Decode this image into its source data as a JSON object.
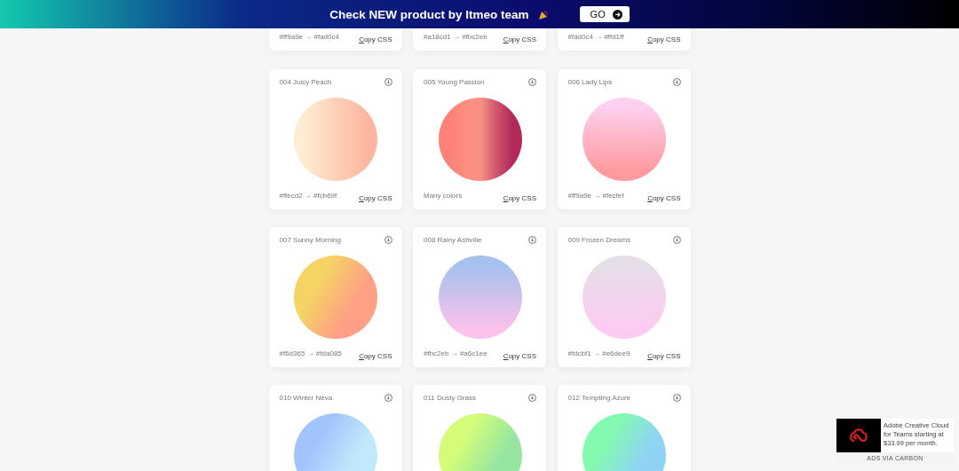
{
  "banner": {
    "text": "Check NEW product by Itmeo team",
    "button": "GO"
  },
  "cards": [
    {
      "colors_text": "#ff9a9e → #fad0c4",
      "copy": "Copy CSS"
    },
    {
      "colors_text": "#a18cd1 → #fbc2eb",
      "copy": "Copy CSS"
    },
    {
      "colors_text": "#fad0c4 → #ffd1ff",
      "copy": "Copy CSS"
    },
    {
      "title": "004 Juicy Peach",
      "swatch": {
        "kind": "horizontal",
        "stops": [
          {
            "color": "#ffecd2"
          },
          {
            "color": "#fcb69f"
          }
        ]
      },
      "colors_text": "#ffecd2 → #fcb69f",
      "copy": "Copy CSS"
    },
    {
      "title": "005 Young Passion",
      "swatch": {
        "kind": "horizontal",
        "stops": [
          {
            "color": "#ff8177"
          },
          {
            "color": "#ff8c7f"
          },
          {
            "color": "#f99185"
          },
          {
            "color": "#cf556c"
          },
          {
            "color": "#b12a5b"
          }
        ]
      },
      "colors_text": "Many colors",
      "copy": "Copy CSS"
    },
    {
      "title": "006 Lady Lips",
      "swatch": {
        "kind": "vertical",
        "stops": [
          {
            "color": "#ff9a9e"
          },
          {
            "color": "#fecfef"
          }
        ]
      },
      "colors_text": "#ff9a9e → #fecfef",
      "copy": "Copy CSS"
    },
    {
      "title": "007 Sunny Morning",
      "swatch": {
        "kind": "diagonal",
        "stops": [
          {
            "color": "#f6d365"
          },
          {
            "color": "#fda085"
          }
        ]
      },
      "colors_text": "#f6d365 → #fda085",
      "copy": "Copy CSS"
    },
    {
      "title": "008 Rainy Ashville",
      "swatch": {
        "kind": "vertical",
        "stops": [
          {
            "color": "#fbc2eb"
          },
          {
            "color": "#a6c1ee"
          }
        ]
      },
      "colors_text": "#fbc2eb → #a6c1ee",
      "copy": "Copy CSS"
    },
    {
      "title": "009 Frozen Dreams",
      "swatch": {
        "kind": "vertical",
        "stops": [
          {
            "color": "#fdcbf1"
          },
          {
            "color": "#e6dee9"
          }
        ]
      },
      "colors_text": "#fdcbf1 → #e6dee9",
      "copy": "Copy CSS"
    },
    {
      "title": "010 Winter Neva",
      "swatch": {
        "kind": "diagonal",
        "stops": [
          {
            "color": "#a1c4fd"
          },
          {
            "color": "#c2e9fb"
          }
        ]
      }
    },
    {
      "title": "011 Dusty Grass",
      "swatch": {
        "kind": "diagonal",
        "stops": [
          {
            "color": "#d4fc79"
          },
          {
            "color": "#96e6a1"
          }
        ]
      }
    },
    {
      "title": "012 Tempting Azure",
      "swatch": {
        "kind": "diagonal",
        "stops": [
          {
            "color": "#84fab0"
          },
          {
            "color": "#8fd3f4"
          }
        ]
      }
    }
  ],
  "ad": {
    "text": "Adobe Creative Cloud for Teams starting at $33.99 per month.",
    "footer": "ADS VIA CARBON"
  }
}
